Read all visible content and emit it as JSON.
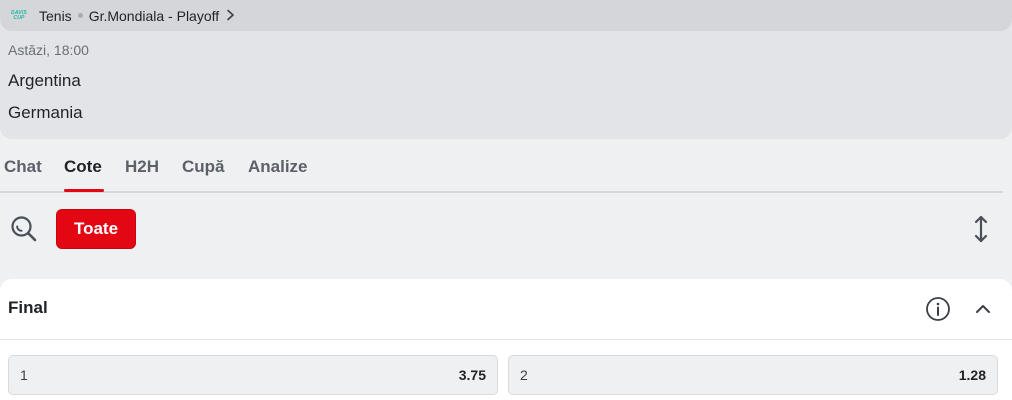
{
  "event": {
    "league_logo_text": [
      "DAVIS",
      "CUP"
    ],
    "sport": "Tenis",
    "competition": "Gr.Mondiala - Playoff",
    "time": "Astăzi, 18:00",
    "home_team": "Argentina",
    "away_team": "Germania"
  },
  "tabs": [
    {
      "label": "Chat",
      "active": false
    },
    {
      "label": "Cote",
      "active": true
    },
    {
      "label": "H2H",
      "active": false
    },
    {
      "label": "Cupă",
      "active": false
    },
    {
      "label": "Analize",
      "active": false
    }
  ],
  "filters": {
    "search_icon": "search-icon",
    "chip_label": "Toate",
    "sort_icon": "expand-collapse-icon"
  },
  "market": {
    "title": "Final",
    "info_icon": "info-icon",
    "collapse_icon": "chevron-up-icon",
    "odds": [
      {
        "label": "1",
        "value": "3.75"
      },
      {
        "label": "2",
        "value": "1.28"
      }
    ]
  },
  "colors": {
    "accent": "#e30613",
    "logo": "#20b7a4"
  }
}
